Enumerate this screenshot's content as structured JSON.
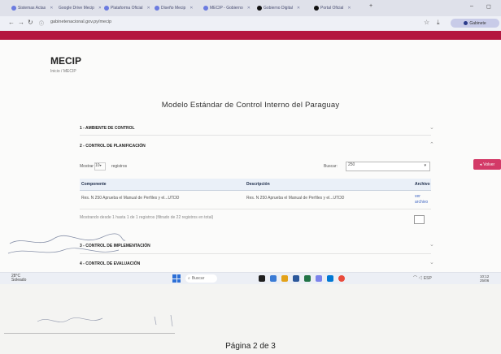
{
  "browser": {
    "tabs": [
      {
        "label": "Sistemas Actas"
      },
      {
        "label": "Google Drive Mecip"
      },
      {
        "label": "Plataforma Oficial"
      },
      {
        "label": "Diseño Mecip"
      },
      {
        "label": "MECIP - Gobierno"
      },
      {
        "label": "Gobierno Digital"
      },
      {
        "label": "Portal Oficial"
      }
    ],
    "url": "gabinetenacional.gov.py/mecip",
    "profile_label": "Gabinete"
  },
  "page": {
    "title": "MECIP",
    "breadcrumb": "Inicio  /  MECIP",
    "heading": "Modelo Estándar de Control Interno del Paraguay",
    "side_button": "Volver"
  },
  "sections": [
    {
      "label": "1 - AMBIENTE DE CONTROL"
    },
    {
      "label": "2 - CONTROL DE PLANIFICACIÓN"
    },
    {
      "label": "3 - CONTROL DE IMPLEMENTACIÓN"
    },
    {
      "label": "4 - CONTROL DE EVALUACIÓN"
    }
  ],
  "table": {
    "show_label": "Mostrar",
    "show_value": "10",
    "show_suffix": "registros",
    "search_label": "Buscar:",
    "search_value": "250",
    "headers": [
      "Componente",
      "Descripción",
      "Archivo"
    ],
    "rows": [
      {
        "componente": "Res. N 250 Aprueba el Manual de Perfiles y el...UTDD",
        "descripcion": "Res. N 250 Aprueba el Manual de Perfiles y el...UTDD",
        "archivo": "ver archivo"
      }
    ],
    "info": "Mostrando desde 1 hasta 1 de 1 registros (filtrado de 22 registros en total)"
  },
  "taskbar": {
    "weather_temp": "28°C",
    "weather_desc": "Soleado",
    "search_label": "Buscar",
    "tray": "ESP",
    "time": "10:12",
    "date": "25/06"
  },
  "footer": "Página 2 de 3"
}
